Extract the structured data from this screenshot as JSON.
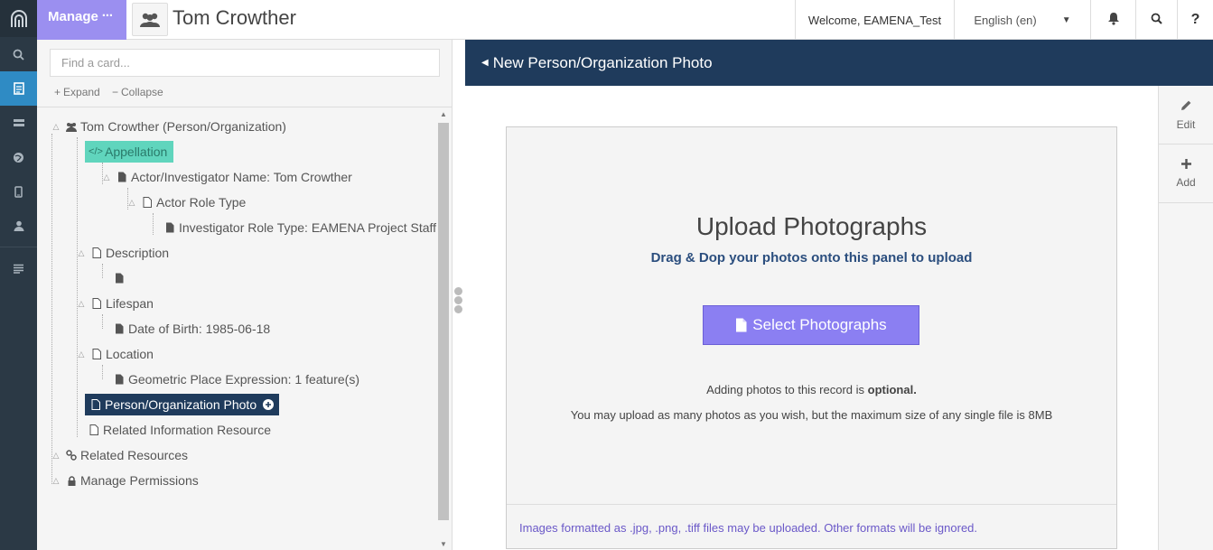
{
  "header": {
    "manage_label": "Manage",
    "manage_dots": "⋯",
    "resource_name": "Tom Crowther",
    "welcome": "Welcome, EAMENA_Test",
    "language": "English (en)",
    "help": "?"
  },
  "tree": {
    "search_placeholder": "Find a card...",
    "expand_label": "Expand",
    "collapse_label": "Collapse",
    "nodes": [
      {
        "label": "Tom Crowther (Person/Organization)"
      },
      {
        "label": "Appellation"
      },
      {
        "label": "Actor/Investigator Name: Tom Crowther"
      },
      {
        "label": "Actor Role Type"
      },
      {
        "label": "Investigator Role Type: EAMENA Project Staff"
      },
      {
        "label": "Description"
      },
      {
        "label": ""
      },
      {
        "label": "Lifespan"
      },
      {
        "label": "Date of Birth: 1985-06-18"
      },
      {
        "label": "Location"
      },
      {
        "label": "Geometric Place Expression: 1 feature(s)"
      },
      {
        "label": "Person/Organization Photo"
      },
      {
        "label": "Related Information Resource"
      },
      {
        "label": "Related Resources"
      },
      {
        "label": "Manage Permissions"
      }
    ]
  },
  "form": {
    "title": "New Person/Organization Photo",
    "upload_title": "Upload Photographs",
    "upload_subtitle": "Drag & Dop your photos onto this panel to upload",
    "select_button": "Select Photographs",
    "optional_prefix": "Adding photos to this record is ",
    "optional_bold": "optional.",
    "max_size_text": "You may upload as many photos as you wish, but the maximum size of any single file is 8MB",
    "formats_note": "Images formatted as .jpg, .png, .tiff files may be uploaded. Other formats will be ignored."
  },
  "side_tools": {
    "edit_label": "Edit",
    "add_label": "Add"
  },
  "colors": {
    "rail_bg": "#2b3945",
    "manage_bg": "#9b8ff0",
    "header_navy": "#1f3b5c",
    "selected_card": "#60d5bd",
    "button_purple": "#8b7ff2"
  }
}
